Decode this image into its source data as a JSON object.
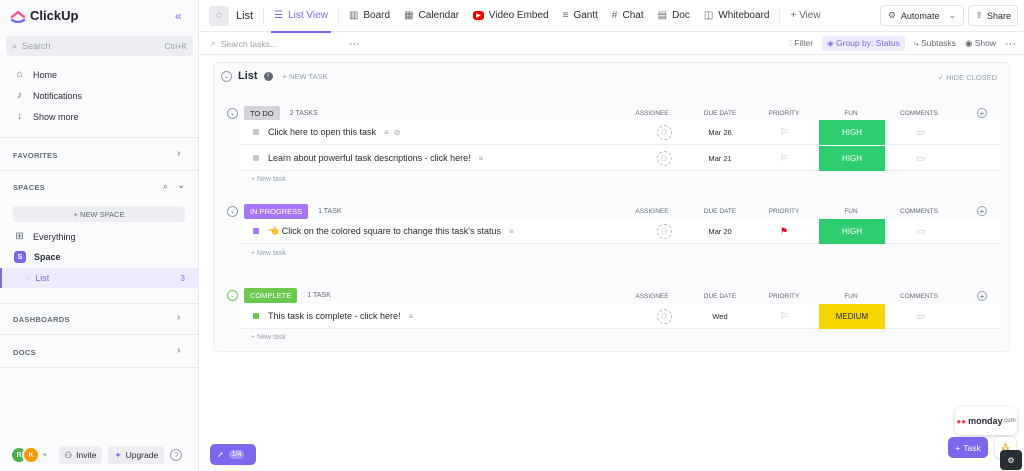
{
  "app": {
    "name": "ClickUp"
  },
  "sidebar": {
    "search_placeholder": "Search",
    "search_shortcut": "Ctrl+K",
    "nav": [
      {
        "label": "Home",
        "icon": "home-icon"
      },
      {
        "label": "Notifications",
        "icon": "bell-icon"
      },
      {
        "label": "Show more",
        "icon": "arrow-down-icon"
      }
    ],
    "favorites": "FAVORITES",
    "spaces": "SPACES",
    "new_space": "+ NEW SPACE",
    "everything": "Everything",
    "space_badge": "S",
    "space_name": "Space",
    "list_name": "List",
    "list_count": "3",
    "dashboards": "DASHBOARDS",
    "docs": "DOCS",
    "avatars": [
      {
        "initial": "R",
        "color": "#4caf50"
      },
      {
        "initial": "K",
        "color": "#ff9800"
      }
    ],
    "invite": "Invite",
    "upgrade": "Upgrade",
    "help": "?"
  },
  "topbar": {
    "crumb": "List",
    "tabs": [
      {
        "label": "List View",
        "icon": "list-icon",
        "active": true
      },
      {
        "label": "Board",
        "icon": "board-icon"
      },
      {
        "label": "Calendar",
        "icon": "calendar-icon"
      },
      {
        "label": "Video Embed",
        "icon": "youtube-icon"
      },
      {
        "label": "Gantt",
        "icon": "gantt-icon"
      },
      {
        "label": "Chat",
        "icon": "hash-icon"
      },
      {
        "label": "Doc",
        "icon": "doc-icon"
      },
      {
        "label": "Whiteboard",
        "icon": "whiteboard-icon"
      }
    ],
    "add_view": "+ View",
    "automate": "Automate",
    "share": "Share"
  },
  "toolbar": {
    "search_placeholder": "Search tasks...",
    "filter": "Filter",
    "group_by": "Group by: Status",
    "subtasks": "Subtasks",
    "show": "Show"
  },
  "main": {
    "title": "List",
    "new_task_top": "+ NEW TASK",
    "hide_closed": "✓ HIDE CLOSED",
    "columns": {
      "assignee": "ASSIGNEE",
      "due": "DUE DATE",
      "priority": "PRIORITY",
      "fun": "FUN",
      "comments": "COMMENTS"
    },
    "new_task": "+ New task",
    "groups": [
      {
        "status": "TO DO",
        "status_bg": "#d3d5d9",
        "status_fg": "#292d34",
        "count": "2 TASKS",
        "tasks": [
          {
            "name": "Click here to open this task",
            "due": "Mar 26",
            "flag_color": "#b7bcc4",
            "fun": "HIGH",
            "fun_bg": "#2ecd6f",
            "fun_fg": "#fff",
            "sq": "#c4c8cf"
          },
          {
            "name": "Learn about powerful task descriptions - click here!",
            "due": "Mar 21",
            "flag_color": "#b7bcc4",
            "fun": "HIGH",
            "fun_bg": "#2ecd6f",
            "fun_fg": "#fff",
            "sq": "#c4c8cf"
          }
        ]
      },
      {
        "status": "IN PROGRESS",
        "status_bg": "#a875ff",
        "status_fg": "#fff",
        "count": "1 TASK",
        "tasks": [
          {
            "name": "👈 Click on the colored square to change this task's status",
            "due": "Mar 20",
            "flag_color": "#e5002b",
            "fun": "HIGH",
            "fun_bg": "#2ecd6f",
            "fun_fg": "#fff",
            "sq": "#a875ff"
          }
        ]
      },
      {
        "status": "COMPLETE",
        "status_bg": "#6bc950",
        "status_fg": "#fff",
        "count": "1 TASK",
        "tasks": [
          {
            "name": "This task is complete - click here!",
            "due": "Wed",
            "flag_color": "#b7bcc4",
            "fun": "MEDIUM",
            "fun_bg": "#f5d400",
            "fun_fg": "#292d34",
            "sq": "#6bc950"
          }
        ]
      }
    ]
  },
  "floating": {
    "onboarding": "1/4",
    "monday": "monday",
    "monday_suffix": ".com",
    "task_btn": "Task"
  }
}
